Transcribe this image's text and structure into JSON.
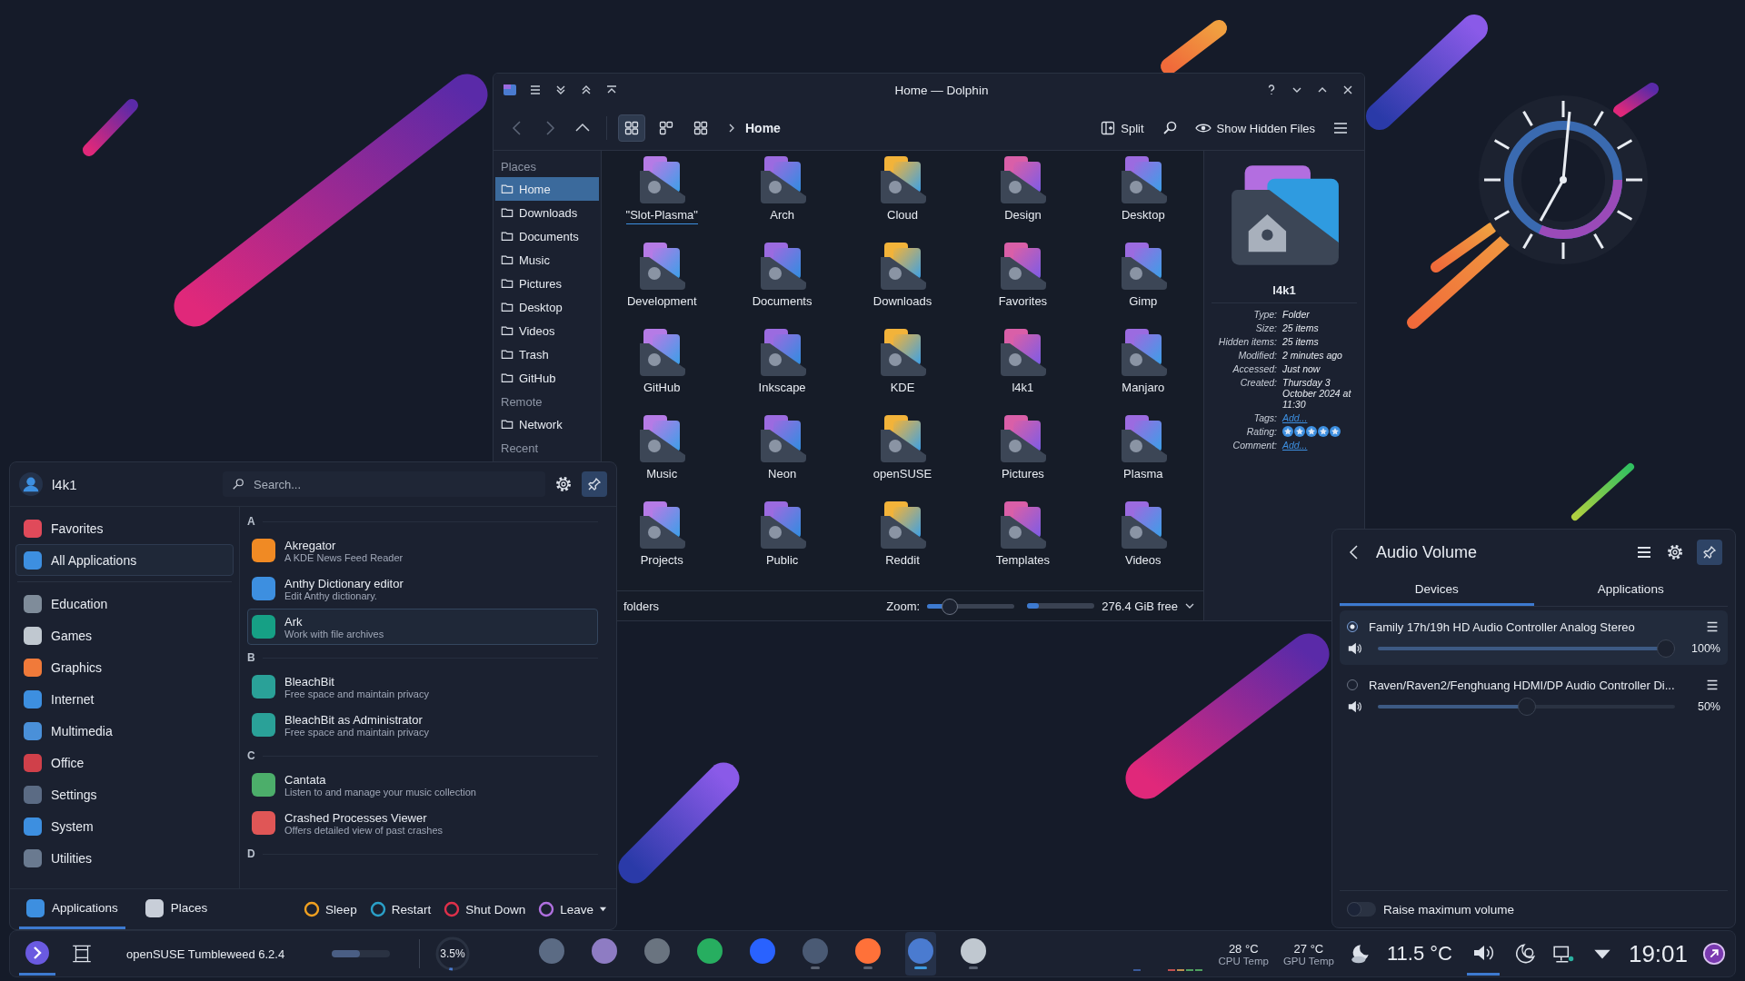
{
  "dolphin": {
    "title": "Home — Dolphin",
    "toolbar": {
      "view_modes": [
        {
          "selected": true
        },
        {
          "selected": false
        },
        {
          "selected": false
        }
      ],
      "breadcrumb": "Home",
      "split": "Split",
      "show_hidden": "Show Hidden Files"
    },
    "places": [
      {
        "kind": "heading",
        "label": "Places"
      },
      {
        "kind": "item",
        "label": "Home",
        "selected": true
      },
      {
        "kind": "item",
        "label": "Downloads",
        "selected": false
      },
      {
        "kind": "item",
        "label": "Documents",
        "selected": false
      },
      {
        "kind": "item",
        "label": "Music",
        "selected": false
      },
      {
        "kind": "item",
        "label": "Pictures",
        "selected": false
      },
      {
        "kind": "item",
        "label": "Desktop",
        "selected": false
      },
      {
        "kind": "item",
        "label": "Videos",
        "selected": false
      },
      {
        "kind": "item",
        "label": "Trash",
        "selected": false
      },
      {
        "kind": "item",
        "label": "GitHub",
        "selected": false
      },
      {
        "kind": "heading",
        "label": "Remote"
      },
      {
        "kind": "item",
        "label": "Network",
        "selected": false
      },
      {
        "kind": "heading",
        "label": "Recent"
      }
    ],
    "folders": [
      {
        "name": "\"Slot-Plasma\"",
        "focused": true
      },
      {
        "name": "Arch",
        "focused": false
      },
      {
        "name": "Cloud",
        "focused": false
      },
      {
        "name": "Design",
        "focused": false
      },
      {
        "name": "Desktop",
        "focused": false
      },
      {
        "name": "Development",
        "focused": false
      },
      {
        "name": "Documents",
        "focused": false
      },
      {
        "name": "Downloads",
        "focused": false
      },
      {
        "name": "Favorites",
        "focused": false
      },
      {
        "name": "Gimp",
        "focused": false
      },
      {
        "name": "GitHub",
        "focused": false
      },
      {
        "name": "Inkscape",
        "focused": false
      },
      {
        "name": "KDE",
        "focused": false
      },
      {
        "name": "l4k1",
        "focused": false
      },
      {
        "name": "Manjaro",
        "focused": false
      },
      {
        "name": "Music",
        "focused": false
      },
      {
        "name": "Neon",
        "focused": false
      },
      {
        "name": "openSUSE",
        "focused": false
      },
      {
        "name": "Pictures",
        "focused": false
      },
      {
        "name": "Plasma",
        "focused": false
      },
      {
        "name": "Projects",
        "focused": false
      },
      {
        "name": "Public",
        "focused": false
      },
      {
        "name": "Reddit",
        "focused": false
      },
      {
        "name": "Templates",
        "focused": false
      },
      {
        "name": "Videos",
        "focused": false
      }
    ],
    "status": {
      "text": "folders",
      "zoom": {
        "label": "Zoom:",
        "level": 0.25
      },
      "space": {
        "level": 0.18,
        "text": "276.4 GiB free"
      }
    },
    "info": {
      "name": "l4k1",
      "properties": [
        {
          "key": "Type:",
          "kind": "text",
          "value": "Folder"
        },
        {
          "key": "Size:",
          "kind": "text",
          "value": "25 items"
        },
        {
          "key": "Hidden items:",
          "kind": "text",
          "value": "25 items"
        },
        {
          "key": "Modified:",
          "kind": "text",
          "value": "2 minutes ago"
        },
        {
          "key": "Accessed:",
          "kind": "text",
          "value": "Just now"
        },
        {
          "key": "Created:",
          "kind": "text",
          "value": "Thursday 3 October 2024 at 11:30"
        },
        {
          "key": "Tags:",
          "kind": "link",
          "value": "Add..."
        },
        {
          "key": "Rating:",
          "kind": "stars",
          "stars": 5
        },
        {
          "key": "Comment:",
          "kind": "link",
          "value": "Add..."
        }
      ]
    }
  },
  "launcher": {
    "user": "l4k1",
    "search": {
      "placeholder": "Search..."
    },
    "pinned": true,
    "top_categories": [
      {
        "label": "Favorites",
        "selected": false
      },
      {
        "label": "All Applications",
        "selected": true
      }
    ],
    "categories": [
      {
        "label": "Education",
        "selected": false
      },
      {
        "label": "Games",
        "selected": false
      },
      {
        "label": "Graphics",
        "selected": false
      },
      {
        "label": "Internet",
        "selected": false
      },
      {
        "label": "Multimedia",
        "selected": false
      },
      {
        "label": "Office",
        "selected": false
      },
      {
        "label": "Settings",
        "selected": false
      },
      {
        "label": "System",
        "selected": false
      },
      {
        "label": "Utilities",
        "selected": false
      }
    ],
    "apps": [
      {
        "kind": "heading",
        "label": "A"
      },
      {
        "kind": "app",
        "name": "Akregator",
        "description": "A KDE News Feed Reader",
        "selected": false
      },
      {
        "kind": "app",
        "name": "Anthy Dictionary editor",
        "description": "Edit Anthy dictionary.",
        "selected": false
      },
      {
        "kind": "app",
        "name": "Ark",
        "description": "Work with file archives",
        "selected": true
      },
      {
        "kind": "heading",
        "label": "B"
      },
      {
        "kind": "app",
        "name": "BleachBit",
        "description": "Free space and maintain privacy",
        "selected": false
      },
      {
        "kind": "app",
        "name": "BleachBit as Administrator",
        "description": "Free space and maintain privacy",
        "selected": false
      },
      {
        "kind": "heading",
        "label": "C"
      },
      {
        "kind": "app",
        "name": "Cantata",
        "description": "Listen to and manage your music collection",
        "selected": false
      },
      {
        "kind": "app",
        "name": "Crashed Processes Viewer",
        "description": "Offers detailed view of past crashes",
        "selected": false
      },
      {
        "kind": "heading",
        "label": "D"
      }
    ],
    "footer_tabs": [
      {
        "label": "Applications",
        "selected": true
      },
      {
        "label": "Places",
        "selected": false
      }
    ],
    "actions": [
      {
        "label": "Sleep",
        "kind": "button"
      },
      {
        "label": "Restart",
        "kind": "button"
      },
      {
        "label": "Shut Down",
        "kind": "button"
      },
      {
        "label": "Leave",
        "kind": "menu"
      }
    ]
  },
  "audio": {
    "title": "Audio Volume",
    "pinned": true,
    "tabs": [
      {
        "label": "Devices",
        "selected": true
      },
      {
        "label": "Applications",
        "selected": false
      }
    ],
    "devices": [
      {
        "name": "Family 17h/19h HD Audio Controller Analog Stereo",
        "selected": true,
        "level": 1,
        "reading": "100%"
      },
      {
        "name": "Raven/Raven2/Fenghuang HDMI/DP Audio Controller Di...",
        "selected": false,
        "level": 0.5,
        "reading": "50%"
      }
    ],
    "raise_max": {
      "label": "Raise maximum volume",
      "on": false
    }
  },
  "taskbar": {
    "launcher_open": true,
    "os_label": "openSUSE Tumbleweed 6.2.4",
    "memory": {
      "level": 0.49
    },
    "cpu": {
      "reading": "3.5%",
      "level": 0.035
    },
    "tasks": [
      {
        "running": false,
        "active": false
      },
      {
        "running": false,
        "active": false
      },
      {
        "running": false,
        "active": false
      },
      {
        "running": false,
        "active": false
      },
      {
        "running": false,
        "active": false
      },
      {
        "running": true,
        "active": false
      },
      {
        "running": true,
        "active": false
      },
      {
        "running": true,
        "active": true
      },
      {
        "running": true,
        "active": false
      }
    ],
    "temps": [
      {
        "value": "28 °C",
        "label": "CPU Temp"
      },
      {
        "value": "27 °C",
        "label": "GPU Temp"
      }
    ],
    "weather": "11.5 °C",
    "volume_open": true,
    "clock": "19:01"
  }
}
